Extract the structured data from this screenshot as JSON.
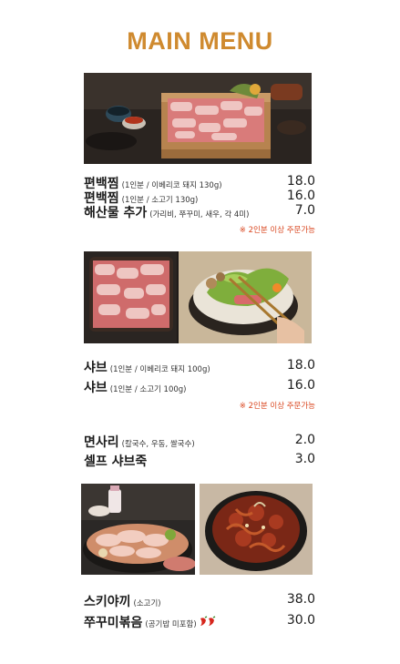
{
  "title": "MAIN MENU",
  "accent_color": "#cf8a2f",
  "note_color": "#d9461f",
  "sections": [
    {
      "items": [
        {
          "name": "편백찜",
          "detail": "(1인분 / 이베리코 돼지 130g)",
          "price": "18.0"
        },
        {
          "name": "편백찜",
          "detail": "(1인분 / 소고기 130g)",
          "price": "16.0"
        },
        {
          "name": "해산물 추가",
          "detail": "(가리비, 쭈꾸미, 새우, 각 4미)",
          "price": "7.0"
        }
      ],
      "note": "※ 2인분 이상 주문가능"
    },
    {
      "items": [
        {
          "name": "샤브",
          "detail": "(1인분 / 이베리코 돼지 100g)",
          "price": "18.0"
        },
        {
          "name": "샤브",
          "detail": "(1인분 / 소고기 100g)",
          "price": "16.0"
        }
      ],
      "note": "※ 2인분 이상 주문가능"
    },
    {
      "items": [
        {
          "name": "면사리",
          "detail": "(칼국수, 우동, 쌀국수)",
          "price": "2.0"
        },
        {
          "name": "셀프 샤브죽",
          "detail": "",
          "price": "3.0"
        }
      ]
    },
    {
      "items": [
        {
          "name": "스키야끼",
          "detail": "(소고기)",
          "price": "38.0"
        },
        {
          "name": "쭈꾸미볶음",
          "detail": "(공기밥 미포함)",
          "price": "30.0",
          "spicy_icon": "chili-pepper-icon",
          "spicy_count": 2
        }
      ]
    }
  ]
}
